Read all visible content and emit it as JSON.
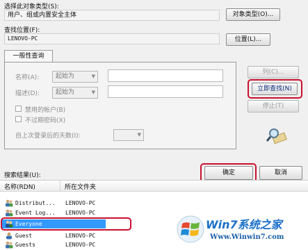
{
  "top": {
    "object_type_label": "选择此对象类型(S):",
    "object_type_value": "用户、组或内置安全主体",
    "object_type_button": "对象类型(O)...",
    "location_label": "查找位置(F):",
    "location_value": "LENOVO-PC",
    "location_button": "位置(L)..."
  },
  "query": {
    "tab_label": "一般性查询",
    "name_label": "名称(A):",
    "name_combo": "起始为",
    "desc_label": "描述(D):",
    "desc_combo": "起始为",
    "disabled_accounts": "禁用的帐户(B)",
    "no_expire_pwd": "不过期密码(X)",
    "days_since_login": "自上次登录后的天数(I):"
  },
  "side_buttons": {
    "columns": "列(C)...",
    "find_now": "立即查找(N)",
    "stop": "停止(T)"
  },
  "footer": {
    "results_label": "搜索结果(U):",
    "ok": "确定",
    "cancel": "取消"
  },
  "table": {
    "columns": [
      "名称(RDN)",
      "所在文件夹"
    ],
    "rows": [
      {
        "name": "Distribut...",
        "folder": "LENOVO-PC"
      },
      {
        "name": "Event Log...",
        "folder": "LENOVO-PC"
      },
      {
        "name": "Everyone",
        "folder": ""
      },
      {
        "name": "Guest",
        "folder": "LENOVO-PC"
      },
      {
        "name": "Guests",
        "folder": "LENOVO-PC"
      }
    ]
  },
  "watermark": {
    "brand": "Win7系统之家",
    "url": "Www.Winwin7.com"
  },
  "colors": {
    "highlight_red": "#c8102e",
    "selection_blue": "#3399ff"
  }
}
